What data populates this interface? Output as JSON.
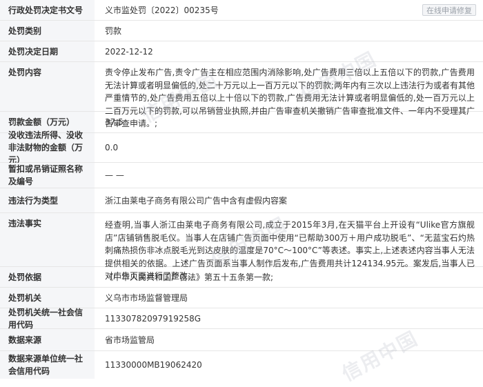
{
  "rows": [
    {
      "label": "行政处罚决定书文号",
      "value": "义市监处罚〔2022〕00235号",
      "button": "在线申请修复"
    },
    {
      "label": "处罚类别",
      "value": "罚款"
    },
    {
      "label": "处罚决定日期",
      "value": "2022-12-12"
    },
    {
      "label": "处罚内容",
      "value": "责令停止发布广告,责令广告主在相应范围内消除影响,处广告费用三倍以上五倍以下的罚款,广告费用无法计算或者明显偏低的,处二十万元以上一百万元以下的罚款;两年内有三次以上违法行为或者有其他严重情节的,处广告费用五倍以上十倍以下的罚款,广告费用无法计算或者明显偏低的,处一百万元以上二百万元以下的罚款,可以吊销营业执照,并由广告审查机关撤销广告审查批准文件、一年内不受理其广告审查申请。;"
    },
    {
      "label": "罚款金额（万元）",
      "value": "37.5"
    },
    {
      "label": "没收违法所得、没收非法财物的金额（万元）",
      "value": "0.0"
    },
    {
      "label": "暂扣或吊销证照名称及编号",
      "value": "— —"
    },
    {
      "label": "违法行为类型",
      "value": "浙江由莱电子商务有限公司广告中含有虚假内容案"
    },
    {
      "label": "违法事实",
      "value": "经查明,当事人浙江由莱电子商务有限公司,成立于2015年3月,在天猫平台上开设有“Ulike官方旗舰店”店铺销售脱毛仪。当事人在店铺广告页面中使用“已帮助300万＋用户成功脱毛”、“无蓝宝石灼热刺痛热损伤非冰点脱毛光到达皮肤的温度是70°C～100°C”等表述。事实上,上述表述内容当事人无法提供相关的依据。上述广告页面系当事人制作后发布,广告费用共计124134.95元。案发后,当事人已对广告页面进行了整改。"
    },
    {
      "label": "处罚依据",
      "value": "《中华人民共和国广告法》第五十五条第一款;"
    },
    {
      "label": "处罚机关",
      "value": "义乌市市场监督管理局"
    },
    {
      "label": "处罚机关统一社会信用代码",
      "value": "11330782097919258G"
    },
    {
      "label": "数据来源",
      "value": "省市场监管局"
    },
    {
      "label": "数据来源单位统一社会信用代码",
      "value": "11330000MB19062420"
    }
  ],
  "watermarks": [
    "信用中国",
    "信用中国",
    "信用中国",
    "信用中国"
  ]
}
